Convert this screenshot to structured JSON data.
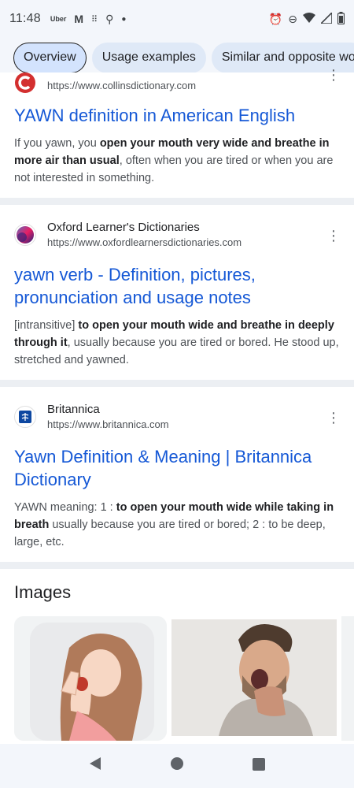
{
  "status_bar": {
    "time": "11:48",
    "left_icons": [
      "uber-icon",
      "gmail-icon",
      "grid-icon",
      "keyhole-icon",
      "dot-icon"
    ],
    "uber_label": "Uber",
    "right_icons": [
      "alarm-icon",
      "dnd-icon",
      "wifi-icon",
      "signal-icon",
      "battery-icon"
    ]
  },
  "chips": [
    {
      "label": "Overview",
      "active": true
    },
    {
      "label": "Usage examples",
      "active": false
    },
    {
      "label": "Similar and opposite wo",
      "active": false
    }
  ],
  "results": [
    {
      "site_name": "",
      "url": "https://www.collinsdictionary.com",
      "title": "YAWN definition in American English",
      "snippet_parts": [
        "If you yawn, you ",
        "open your mouth very wide and breathe in more air than usual",
        ", often when you are tired or when you are not interested in something."
      ]
    },
    {
      "site_name": "Oxford Learner's Dictionaries",
      "url": "https://www.oxfordlearnersdictionaries.com",
      "title": "yawn verb - Definition, pictures, pronunciation and usage notes",
      "snippet_parts": [
        "[intransitive] ",
        "to open your mouth wide and breathe in deeply through it",
        ", usually because you are tired or bored. He stood up, stretched and yawned."
      ]
    },
    {
      "site_name": "Britannica",
      "url": "https://www.britannica.com",
      "title": "Yawn Definition & Meaning | Britannica Dictionary",
      "snippet_parts": [
        "YAWN meaning: 1 : ",
        "to open your mouth wide while taking in breath",
        " usually because you are tired or bored; 2 : to be deep, large, etc."
      ]
    }
  ],
  "images": {
    "heading": "Images"
  },
  "colors": {
    "link": "#1558d6",
    "chip_bg": "#dfe9f7",
    "chip_active_bg": "#d3e3fd",
    "status_bg": "#f3f6fb"
  }
}
